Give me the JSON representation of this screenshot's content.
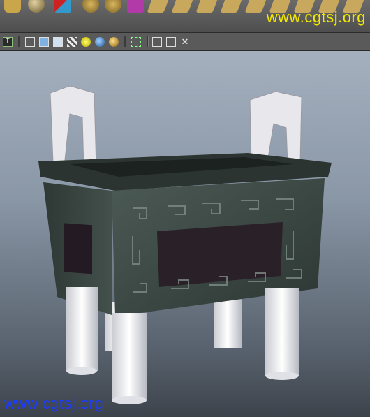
{
  "watermark_top": "www.cgtsj.org",
  "watermark_bottom": "www.cgtsj.org",
  "shelf": {
    "icons": [
      "polygon-cylinder-icon",
      "sphere-settings-icon",
      "transfer-arrows-icon",
      "globe-uv-icon",
      "globe-mesh-icon",
      "material-cube-icon",
      "plane-tool-icon",
      "select-cursor-icon",
      "plane-tool-icon",
      "plane-tool-icon",
      "plane-tool-icon",
      "plane-tool-icon",
      "plane-tool-icon",
      "plane-tool-icon"
    ]
  },
  "panel_toolbar": {
    "text_button_label": "T",
    "icons": [
      "text-toggle-icon",
      "wireframe-cube-icon",
      "shaded-cube-icon",
      "wire-on-shaded-icon",
      "textured-cube-icon",
      "default-light-icon",
      "all-lights-icon",
      "shadow-icon",
      "isolate-select-icon",
      "smooth-shade-icon",
      "xray-icon",
      "camera-settings-icon"
    ]
  },
  "viewport": {
    "top_color": "#a4b0be",
    "bottom_color": "#3d434b",
    "object": "bronze-ding-model"
  },
  "colors": {
    "watermark_top": "#f3e800",
    "watermark_bottom": "#1a3cff",
    "bronze": "#3a4642",
    "handle": "#e8e8ec"
  }
}
